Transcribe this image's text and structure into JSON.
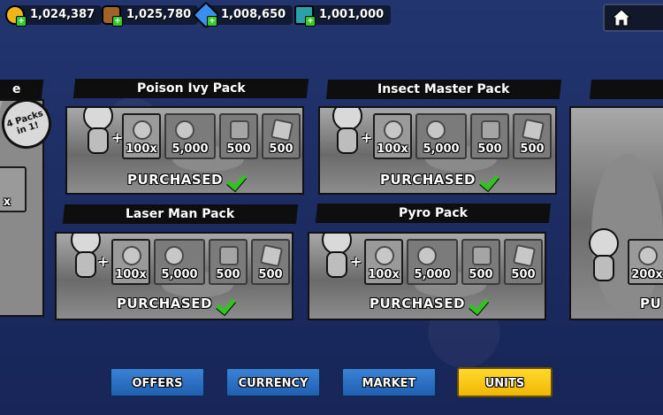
{
  "resources": [
    {
      "name": "coins",
      "value": "1,024,387",
      "icon": "coin-icon",
      "color": "#f0b51a"
    },
    {
      "name": "wood",
      "value": "1,025,780",
      "icon": "log-icon",
      "color": "#a0642a"
    },
    {
      "name": "gems",
      "value": "1,008,650",
      "icon": "gem-icon",
      "color": "#3a8ef0"
    },
    {
      "name": "units",
      "value": "1,001,000",
      "icon": "unit-card-icon",
      "color": "#2aa0a8"
    }
  ],
  "packs": [
    {
      "title": "Poison Ivy Pack",
      "items": [
        "100x",
        "5,000",
        "500",
        "500"
      ],
      "status": "PURCHASED"
    },
    {
      "title": "Insect Master Pack",
      "items": [
        "100x",
        "5,000",
        "500",
        "500"
      ],
      "status": "PURCHASED"
    },
    {
      "title": "Laser Man Pack",
      "items": [
        "100x",
        "5,000",
        "500",
        "500"
      ],
      "status": "PURCHASED"
    },
    {
      "title": "Pyro Pack",
      "items": [
        "100x",
        "5,000",
        "500",
        "500"
      ],
      "status": "PURCHASED"
    }
  ],
  "left_partial": {
    "title": "e",
    "badge": "4 Packs in 1!",
    "tile_label": "x"
  },
  "right_partial": {
    "tile_label": "200x",
    "status": "PU"
  },
  "nav": [
    {
      "label": "OFFERS",
      "active": false
    },
    {
      "label": "CURRENCY",
      "active": false
    },
    {
      "label": "MARKET",
      "active": false
    },
    {
      "label": "UNITS",
      "active": true
    }
  ]
}
